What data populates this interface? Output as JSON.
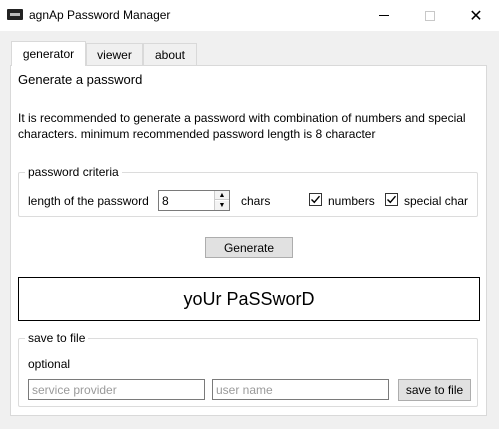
{
  "window": {
    "title": "agnAp Password Manager",
    "min_symbol": "",
    "close_symbol": "✕"
  },
  "tabs": [
    {
      "label": "generator",
      "active": true
    },
    {
      "label": "viewer",
      "active": false
    },
    {
      "label": "about",
      "active": false
    }
  ],
  "generator": {
    "heading": "Generate a password",
    "description": "It is recommended to generate a password with combination of numbers and special characters. minimum recommended password length is 8 character",
    "criteria": {
      "legend": "password criteria",
      "length_label": "length of the password",
      "length_value": "8",
      "unit_label": "chars",
      "numbers_label": "numbers",
      "numbers_checked": true,
      "special_label": "special char",
      "special_checked": true
    },
    "generate_label": "Generate",
    "output_text": "yoUr PaSSworD",
    "save": {
      "legend": "save to file",
      "optional_label": "optional",
      "service_placeholder": "service provider",
      "service_value": "",
      "user_placeholder": "user name",
      "user_value": "",
      "save_label": "save to file"
    }
  }
}
